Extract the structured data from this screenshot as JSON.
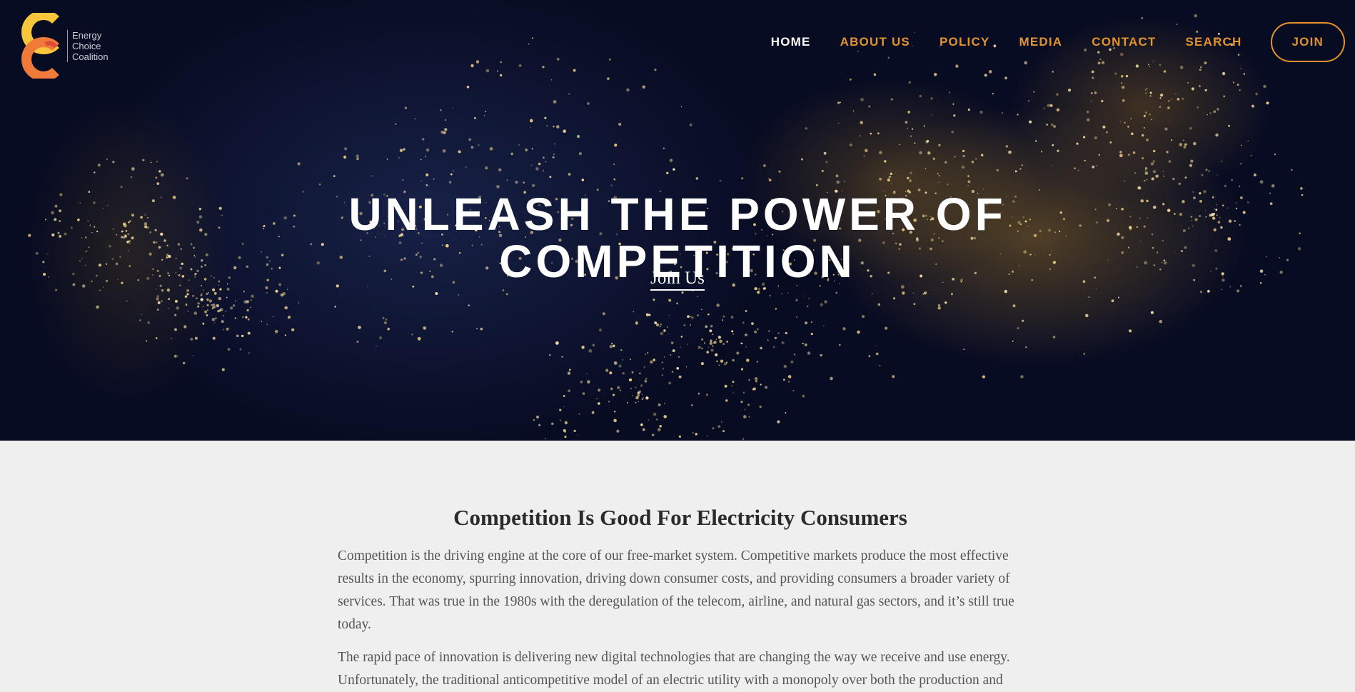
{
  "brand": {
    "logo_lines": [
      "Energy",
      "Choice",
      "Coalition"
    ],
    "colors": {
      "accent": "#e2922e",
      "logo_yellow": "#f7c63a",
      "logo_orange": "#f07a3a",
      "hero_bg": "#080c24"
    }
  },
  "nav": {
    "items": [
      {
        "label": "HOME",
        "active": true
      },
      {
        "label": "ABOUT US",
        "active": false
      },
      {
        "label": "POLICY",
        "active": false
      },
      {
        "label": "MEDIA",
        "active": false
      },
      {
        "label": "CONTACT",
        "active": false
      },
      {
        "label": "SEARCH",
        "active": false
      }
    ],
    "join_label": "JOIN"
  },
  "hero": {
    "title_line1": "UNLEASH THE POWER OF",
    "title_line2": "COMPETITION",
    "cta_label": "Join Us"
  },
  "content": {
    "heading": "Competition Is Good For Electricity Consumers",
    "paragraph1": "Competition is the driving engine at the core of our free-market system. Competitive markets produce the most effective results in the economy, spurring innovation, driving down consumer costs, and providing consumers a broader variety of services. That was true in the 1980s with the deregulation of the telecom, airline, and natural gas sectors, and it’s still true today.",
    "paragraph2": "The rapid pace of innovation is delivering new digital technologies that are changing the way we receive and use energy. Unfortunately, the traditional anticompetitive model of an electric utility with a monopoly over both the production and"
  }
}
